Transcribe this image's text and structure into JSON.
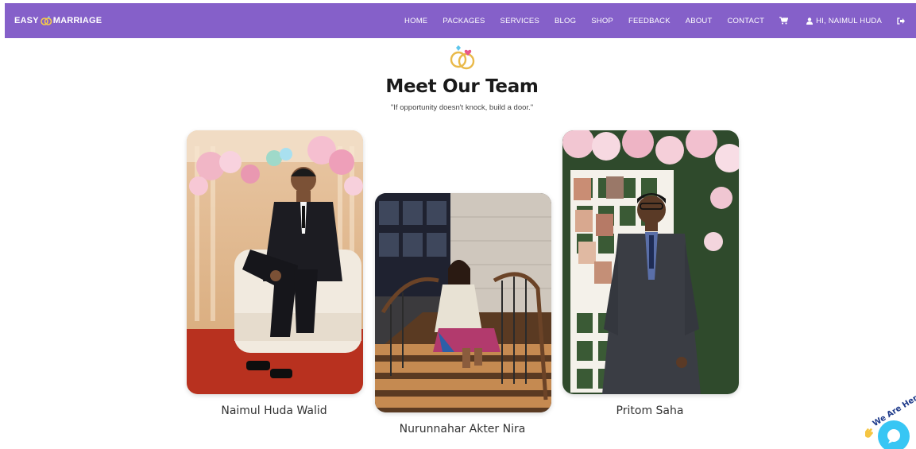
{
  "navbar": {
    "brand_left": "EASY",
    "brand_right": "MARRIAGE",
    "links": [
      "HOME",
      "PACKAGES",
      "SERVICES",
      "BLOG",
      "SHOP",
      "FEEDBACK",
      "ABOUT",
      "CONTACT"
    ],
    "user_greeting": "HI, NAIMUL HUDA",
    "background": "#8560c9"
  },
  "team": {
    "title": "Meet Our Team",
    "quote": "\"If opportunity doesn't knock, build a door.\"",
    "members": [
      {
        "name": "Naimul Huda Walid"
      },
      {
        "name": "Nurunnahar Akter Nira"
      },
      {
        "name": "Pritom Saha"
      }
    ]
  },
  "chat_widget": {
    "label": "We Are Here!",
    "color": "#38c6f4"
  },
  "icons": {
    "cart": "cart-icon",
    "user": "user-icon",
    "logout": "logout-icon",
    "rings": "rings-icon",
    "chat": "chat-icon"
  }
}
